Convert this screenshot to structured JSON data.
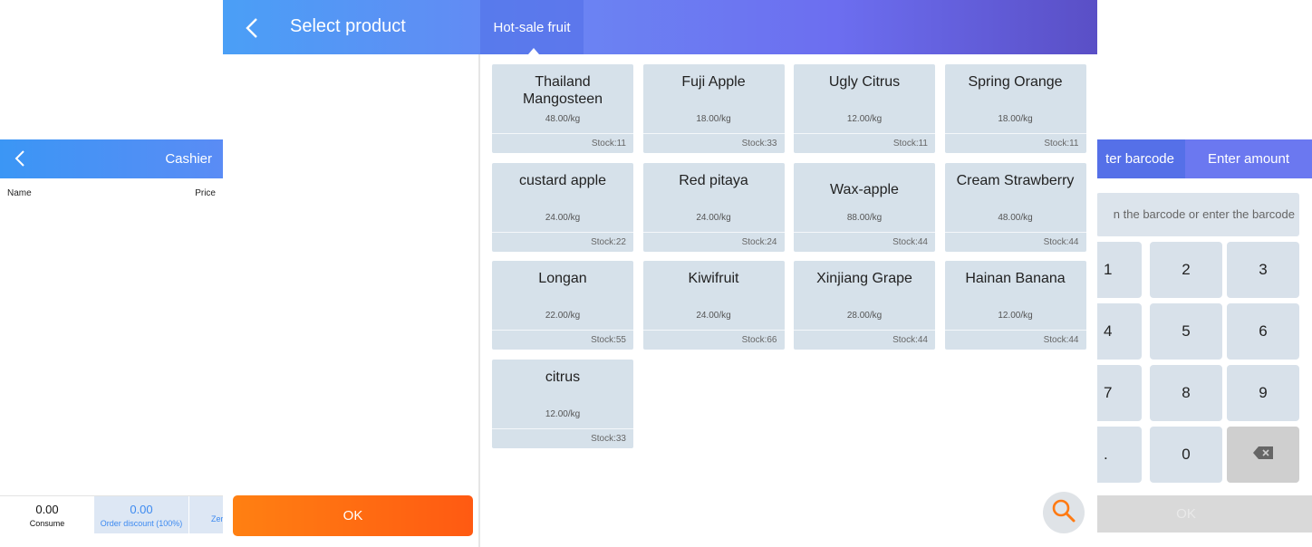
{
  "cashier": {
    "title": "Cashier",
    "columns": {
      "name": "Name",
      "price": "Price"
    },
    "footer": {
      "consume_value": "0.00",
      "consume_label": "Consume",
      "discount_value": "0.00",
      "discount_label": "Order discount (100%)",
      "zero_label": "Zer"
    }
  },
  "keypad": {
    "tab_barcode": "ter barcode",
    "tab_amount": "Enter amount",
    "input_placeholder": "n the barcode or enter the barcode",
    "keys": [
      "1",
      "2",
      "3",
      "4",
      "5",
      "6",
      "7",
      "8",
      "9",
      ".",
      "0"
    ],
    "ok_label": "OK"
  },
  "dialog": {
    "title": "Select product",
    "category_tab": "Hot-sale fruit",
    "ok_label": "OK",
    "products": [
      {
        "name": "Thailand Mangosteen",
        "price": "48.00/kg",
        "stock": "Stock:11"
      },
      {
        "name": "Fuji Apple",
        "price": "18.00/kg",
        "stock": "Stock:33"
      },
      {
        "name": "Ugly Citrus",
        "price": "12.00/kg",
        "stock": "Stock:11"
      },
      {
        "name": "Spring Orange",
        "price": "18.00/kg",
        "stock": "Stock:11"
      },
      {
        "name": "custard apple",
        "price": "24.00/kg",
        "stock": "Stock:22"
      },
      {
        "name": "Red pitaya",
        "price": "24.00/kg",
        "stock": "Stock:24"
      },
      {
        "name": "Wax-apple",
        "price": "88.00/kg",
        "stock": "Stock:44"
      },
      {
        "name": "Cream Strawberry",
        "price": "48.00/kg",
        "stock": "Stock:44"
      },
      {
        "name": "Longan",
        "price": "22.00/kg",
        "stock": "Stock:55"
      },
      {
        "name": "Kiwifruit",
        "price": "24.00/kg",
        "stock": "Stock:66"
      },
      {
        "name": "Xinjiang Grape",
        "price": "28.00/kg",
        "stock": "Stock:44"
      },
      {
        "name": "Hainan Banana",
        "price": "12.00/kg",
        "stock": "Stock:44"
      },
      {
        "name": "citrus",
        "price": "12.00/kg",
        "stock": "Stock:33"
      }
    ]
  },
  "icons": {
    "back": "chevron-left-icon",
    "search": "search-icon",
    "backspace": "backspace-icon"
  },
  "colors": {
    "accent_orange": "#ff6a12",
    "header_blue": "#4a9ff6",
    "header_purple": "#5a4fc6",
    "card_bg": "#d6e1ea",
    "discount_blue": "#3d8af0"
  }
}
